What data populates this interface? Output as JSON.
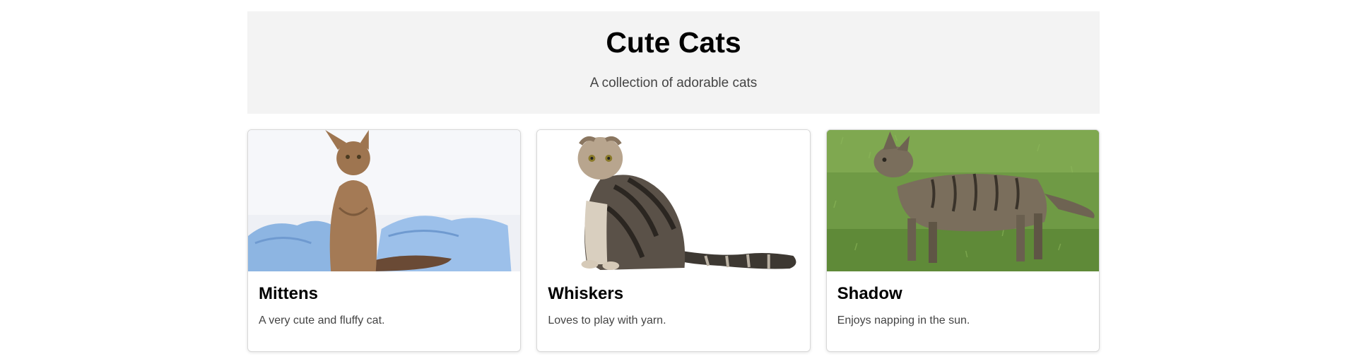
{
  "hero": {
    "title": "Cute Cats",
    "subtitle": "A collection of adorable cats"
  },
  "cards": [
    {
      "title": "Mittens",
      "description": "A very cute and fluffy cat."
    },
    {
      "title": "Whiskers",
      "description": "Loves to play with yarn."
    },
    {
      "title": "Shadow",
      "description": "Enjoys napping in the sun."
    }
  ],
  "colors": {
    "hero_bg": "#f3f3f3",
    "card_border": "#d8d8d8",
    "text_muted": "#444444"
  }
}
